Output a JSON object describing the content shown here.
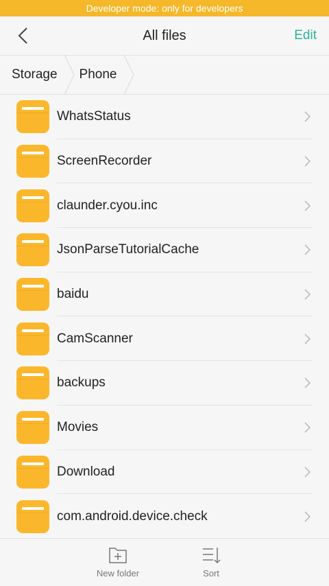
{
  "status_banner": "Developer mode: only for developers",
  "header": {
    "title": "All files",
    "edit_label": "Edit",
    "back_icon": "chevron-left-icon"
  },
  "breadcrumb": [
    {
      "label": "Storage"
    },
    {
      "label": "Phone"
    }
  ],
  "folders": [
    {
      "name": "WhatsStatus"
    },
    {
      "name": "ScreenRecorder"
    },
    {
      "name": "claunder.cyou.inc"
    },
    {
      "name": "JsonParseTutorialCache"
    },
    {
      "name": "baidu"
    },
    {
      "name": "CamScanner"
    },
    {
      "name": "backups"
    },
    {
      "name": "Movies"
    },
    {
      "name": "Download"
    },
    {
      "name": "com.android.device.check"
    }
  ],
  "toolbar": {
    "new_folder_label": "New folder",
    "sort_label": "Sort"
  },
  "colors": {
    "accent": "#2bb39c",
    "banner": "#f5b82a",
    "folder": "#fbb72c"
  }
}
